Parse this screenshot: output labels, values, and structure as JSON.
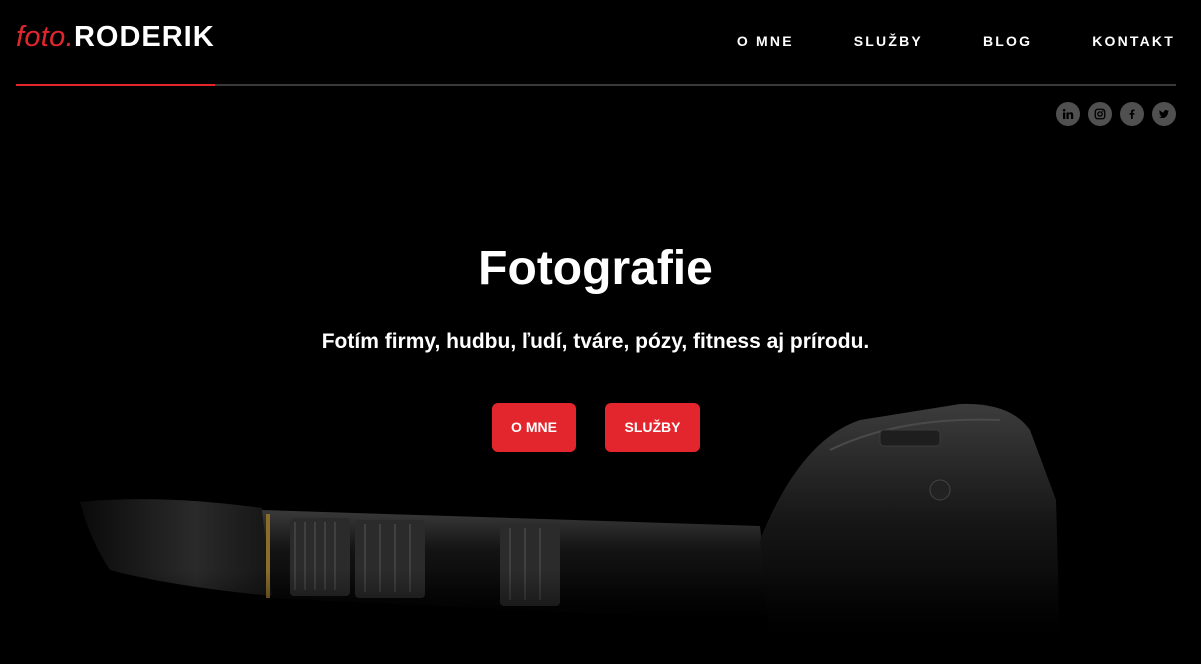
{
  "header": {
    "logo": {
      "prefix": "foto.",
      "name": "RODERIK"
    },
    "nav": [
      {
        "label": "O MNE"
      },
      {
        "label": "SLUŽBY"
      },
      {
        "label": "BLOG"
      },
      {
        "label": "KONTAKT"
      }
    ],
    "social": [
      {
        "icon": "linkedin-icon"
      },
      {
        "icon": "instagram-icon"
      },
      {
        "icon": "facebook-icon"
      },
      {
        "icon": "twitter-icon"
      }
    ]
  },
  "hero": {
    "title": "Fotografie",
    "subtitle": "Fotím firmy, hudbu, ľudí, tváre, pózy, fitness aj prírodu.",
    "buttons": [
      {
        "label": "O MNE"
      },
      {
        "label": "SLUŽBY"
      }
    ],
    "background_image": "camera-with-telephoto-lens"
  },
  "colors": {
    "accent": "#e3262d",
    "background": "#000000",
    "social_circle": "#505050",
    "divider": "#3a3a3a"
  }
}
